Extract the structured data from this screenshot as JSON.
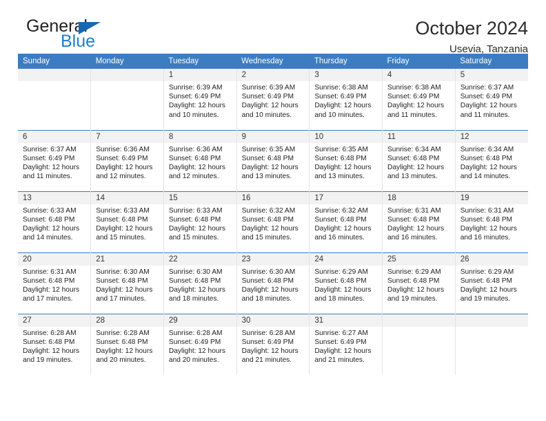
{
  "brand": {
    "name_part1": "General",
    "name_part2": "Blue",
    "accent_color": "#1b7fd4",
    "triangle_color": "#1668b3"
  },
  "header": {
    "title": "October 2024",
    "subtitle": "Usevia, Tanzania"
  },
  "theme": {
    "header_row_bg": "#3b7dc0",
    "header_row_text": "#ffffff",
    "daynum_bg": "#f2f2f2",
    "row_divider": "#3b7dc0"
  },
  "weekdays": [
    "Sunday",
    "Monday",
    "Tuesday",
    "Wednesday",
    "Thursday",
    "Friday",
    "Saturday"
  ],
  "labels": {
    "sunrise_prefix": "Sunrise: ",
    "sunset_prefix": "Sunset: ",
    "daylight_prefix": "Daylight: "
  },
  "weeks": [
    [
      {
        "day": "",
        "blank": true,
        "sunrise": "",
        "sunset": "",
        "daylight_line1": "",
        "daylight_line2": ""
      },
      {
        "day": "",
        "blank": true,
        "sunrise": "",
        "sunset": "",
        "daylight_line1": "",
        "daylight_line2": ""
      },
      {
        "day": "1",
        "blank": false,
        "sunrise": "Sunrise: 6:39 AM",
        "sunset": "Sunset: 6:49 PM",
        "daylight_line1": "Daylight: 12 hours",
        "daylight_line2": "and 10 minutes."
      },
      {
        "day": "2",
        "blank": false,
        "sunrise": "Sunrise: 6:39 AM",
        "sunset": "Sunset: 6:49 PM",
        "daylight_line1": "Daylight: 12 hours",
        "daylight_line2": "and 10 minutes."
      },
      {
        "day": "3",
        "blank": false,
        "sunrise": "Sunrise: 6:38 AM",
        "sunset": "Sunset: 6:49 PM",
        "daylight_line1": "Daylight: 12 hours",
        "daylight_line2": "and 10 minutes."
      },
      {
        "day": "4",
        "blank": false,
        "sunrise": "Sunrise: 6:38 AM",
        "sunset": "Sunset: 6:49 PM",
        "daylight_line1": "Daylight: 12 hours",
        "daylight_line2": "and 11 minutes."
      },
      {
        "day": "5",
        "blank": false,
        "sunrise": "Sunrise: 6:37 AM",
        "sunset": "Sunset: 6:49 PM",
        "daylight_line1": "Daylight: 12 hours",
        "daylight_line2": "and 11 minutes."
      }
    ],
    [
      {
        "day": "6",
        "blank": false,
        "sunrise": "Sunrise: 6:37 AM",
        "sunset": "Sunset: 6:49 PM",
        "daylight_line1": "Daylight: 12 hours",
        "daylight_line2": "and 11 minutes."
      },
      {
        "day": "7",
        "blank": false,
        "sunrise": "Sunrise: 6:36 AM",
        "sunset": "Sunset: 6:49 PM",
        "daylight_line1": "Daylight: 12 hours",
        "daylight_line2": "and 12 minutes."
      },
      {
        "day": "8",
        "blank": false,
        "sunrise": "Sunrise: 6:36 AM",
        "sunset": "Sunset: 6:48 PM",
        "daylight_line1": "Daylight: 12 hours",
        "daylight_line2": "and 12 minutes."
      },
      {
        "day": "9",
        "blank": false,
        "sunrise": "Sunrise: 6:35 AM",
        "sunset": "Sunset: 6:48 PM",
        "daylight_line1": "Daylight: 12 hours",
        "daylight_line2": "and 13 minutes."
      },
      {
        "day": "10",
        "blank": false,
        "sunrise": "Sunrise: 6:35 AM",
        "sunset": "Sunset: 6:48 PM",
        "daylight_line1": "Daylight: 12 hours",
        "daylight_line2": "and 13 minutes."
      },
      {
        "day": "11",
        "blank": false,
        "sunrise": "Sunrise: 6:34 AM",
        "sunset": "Sunset: 6:48 PM",
        "daylight_line1": "Daylight: 12 hours",
        "daylight_line2": "and 13 minutes."
      },
      {
        "day": "12",
        "blank": false,
        "sunrise": "Sunrise: 6:34 AM",
        "sunset": "Sunset: 6:48 PM",
        "daylight_line1": "Daylight: 12 hours",
        "daylight_line2": "and 14 minutes."
      }
    ],
    [
      {
        "day": "13",
        "blank": false,
        "sunrise": "Sunrise: 6:33 AM",
        "sunset": "Sunset: 6:48 PM",
        "daylight_line1": "Daylight: 12 hours",
        "daylight_line2": "and 14 minutes."
      },
      {
        "day": "14",
        "blank": false,
        "sunrise": "Sunrise: 6:33 AM",
        "sunset": "Sunset: 6:48 PM",
        "daylight_line1": "Daylight: 12 hours",
        "daylight_line2": "and 15 minutes."
      },
      {
        "day": "15",
        "blank": false,
        "sunrise": "Sunrise: 6:33 AM",
        "sunset": "Sunset: 6:48 PM",
        "daylight_line1": "Daylight: 12 hours",
        "daylight_line2": "and 15 minutes."
      },
      {
        "day": "16",
        "blank": false,
        "sunrise": "Sunrise: 6:32 AM",
        "sunset": "Sunset: 6:48 PM",
        "daylight_line1": "Daylight: 12 hours",
        "daylight_line2": "and 15 minutes."
      },
      {
        "day": "17",
        "blank": false,
        "sunrise": "Sunrise: 6:32 AM",
        "sunset": "Sunset: 6:48 PM",
        "daylight_line1": "Daylight: 12 hours",
        "daylight_line2": "and 16 minutes."
      },
      {
        "day": "18",
        "blank": false,
        "sunrise": "Sunrise: 6:31 AM",
        "sunset": "Sunset: 6:48 PM",
        "daylight_line1": "Daylight: 12 hours",
        "daylight_line2": "and 16 minutes."
      },
      {
        "day": "19",
        "blank": false,
        "sunrise": "Sunrise: 6:31 AM",
        "sunset": "Sunset: 6:48 PM",
        "daylight_line1": "Daylight: 12 hours",
        "daylight_line2": "and 16 minutes."
      }
    ],
    [
      {
        "day": "20",
        "blank": false,
        "sunrise": "Sunrise: 6:31 AM",
        "sunset": "Sunset: 6:48 PM",
        "daylight_line1": "Daylight: 12 hours",
        "daylight_line2": "and 17 minutes."
      },
      {
        "day": "21",
        "blank": false,
        "sunrise": "Sunrise: 6:30 AM",
        "sunset": "Sunset: 6:48 PM",
        "daylight_line1": "Daylight: 12 hours",
        "daylight_line2": "and 17 minutes."
      },
      {
        "day": "22",
        "blank": false,
        "sunrise": "Sunrise: 6:30 AM",
        "sunset": "Sunset: 6:48 PM",
        "daylight_line1": "Daylight: 12 hours",
        "daylight_line2": "and 18 minutes."
      },
      {
        "day": "23",
        "blank": false,
        "sunrise": "Sunrise: 6:30 AM",
        "sunset": "Sunset: 6:48 PM",
        "daylight_line1": "Daylight: 12 hours",
        "daylight_line2": "and 18 minutes."
      },
      {
        "day": "24",
        "blank": false,
        "sunrise": "Sunrise: 6:29 AM",
        "sunset": "Sunset: 6:48 PM",
        "daylight_line1": "Daylight: 12 hours",
        "daylight_line2": "and 18 minutes."
      },
      {
        "day": "25",
        "blank": false,
        "sunrise": "Sunrise: 6:29 AM",
        "sunset": "Sunset: 6:48 PM",
        "daylight_line1": "Daylight: 12 hours",
        "daylight_line2": "and 19 minutes."
      },
      {
        "day": "26",
        "blank": false,
        "sunrise": "Sunrise: 6:29 AM",
        "sunset": "Sunset: 6:48 PM",
        "daylight_line1": "Daylight: 12 hours",
        "daylight_line2": "and 19 minutes."
      }
    ],
    [
      {
        "day": "27",
        "blank": false,
        "sunrise": "Sunrise: 6:28 AM",
        "sunset": "Sunset: 6:48 PM",
        "daylight_line1": "Daylight: 12 hours",
        "daylight_line2": "and 19 minutes."
      },
      {
        "day": "28",
        "blank": false,
        "sunrise": "Sunrise: 6:28 AM",
        "sunset": "Sunset: 6:48 PM",
        "daylight_line1": "Daylight: 12 hours",
        "daylight_line2": "and 20 minutes."
      },
      {
        "day": "29",
        "blank": false,
        "sunrise": "Sunrise: 6:28 AM",
        "sunset": "Sunset: 6:49 PM",
        "daylight_line1": "Daylight: 12 hours",
        "daylight_line2": "and 20 minutes."
      },
      {
        "day": "30",
        "blank": false,
        "sunrise": "Sunrise: 6:28 AM",
        "sunset": "Sunset: 6:49 PM",
        "daylight_line1": "Daylight: 12 hours",
        "daylight_line2": "and 21 minutes."
      },
      {
        "day": "31",
        "blank": false,
        "sunrise": "Sunrise: 6:27 AM",
        "sunset": "Sunset: 6:49 PM",
        "daylight_line1": "Daylight: 12 hours",
        "daylight_line2": "and 21 minutes."
      },
      {
        "day": "",
        "blank": true,
        "sunrise": "",
        "sunset": "",
        "daylight_line1": "",
        "daylight_line2": ""
      },
      {
        "day": "",
        "blank": true,
        "sunrise": "",
        "sunset": "",
        "daylight_line1": "",
        "daylight_line2": ""
      }
    ]
  ]
}
